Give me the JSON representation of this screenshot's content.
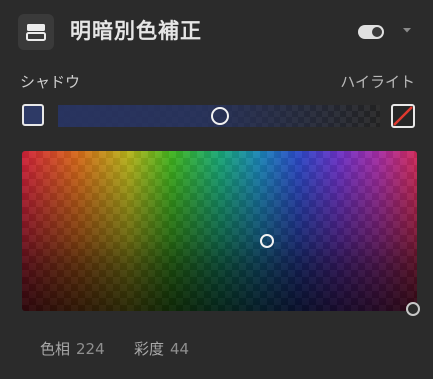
{
  "header": {
    "icon": "layers-panel-icon",
    "title": "明暗別色補正",
    "toggle_on": true
  },
  "balance": {
    "left_label": "シャドウ",
    "right_label": "ハイライト",
    "shadow_color": "#2e3a66",
    "position": 0.5
  },
  "color_field": {
    "hue_position": 0.62,
    "saturation_position": 0.56
  },
  "readout": {
    "hue_label": "色相",
    "hue_value": "224",
    "saturation_label": "彩度",
    "saturation_value": "44"
  }
}
